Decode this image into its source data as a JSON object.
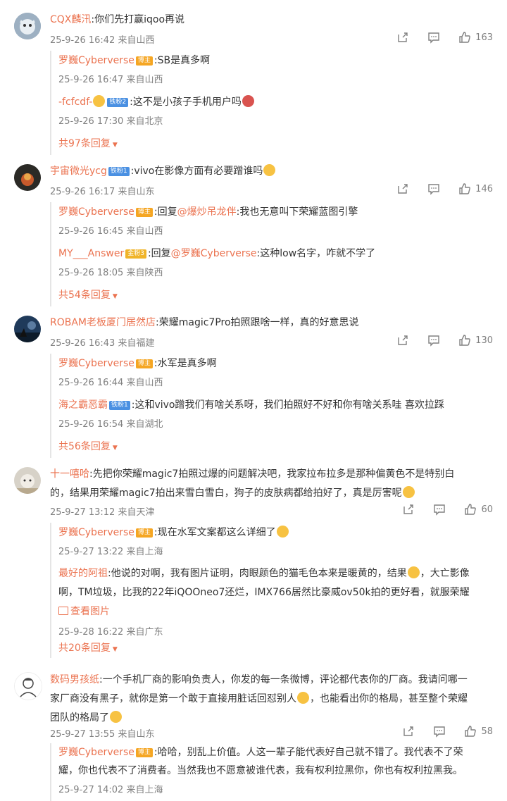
{
  "comments": [
    {
      "user": "CQX麟汛",
      "text": ":你们先打赢iqoo再说",
      "time": "25-9-26 16:42",
      "location": "来自山西",
      "likes": "163",
      "replies": [
        {
          "user": "罗巍Cyberverse",
          "badge": "博主",
          "text": ":SB是真多啊",
          "time": "25-9-26 16:47",
          "location": "来自山西"
        },
        {
          "user": "-fcfcdf-",
          "badge": "铁粉2",
          "text": ":这不是小孩子手机用户吗",
          "time": "25-9-26 17:30",
          "location": "来自北京"
        }
      ],
      "more": "共97条回复"
    },
    {
      "user": "宇宙微光ycg",
      "badge": "铁粉1",
      "text": ":vivo在影像方面有必要蹭谁吗",
      "time": "25-9-26 16:17",
      "location": "来自山东",
      "likes": "146",
      "replies": [
        {
          "user": "罗巍Cyberverse",
          "badge": "博主",
          "prefix": ":回复",
          "mention": "@爆炒吊龙伴",
          "text": ":我也无意叫下荣耀蓝图引擎",
          "time": "25-9-26 16:45",
          "location": "来自山西"
        },
        {
          "user": "MY___Answer",
          "badge": "金粉3",
          "prefix": ":回复",
          "mention": "@罗巍Cyberverse",
          "text": ":这种low名字，咋就不学了",
          "time": "25-9-26 18:05",
          "location": "来自陕西"
        }
      ],
      "more": "共54条回复"
    },
    {
      "user": "ROBAM老板厦门居然店",
      "text": ":荣耀magic7Pro拍照跟啥一样，真的好意思说",
      "time": "25-9-26 16:43",
      "location": "来自福建",
      "likes": "130",
      "replies": [
        {
          "user": "罗巍Cyberverse",
          "badge": "博主",
          "text": ":水军是真多啊",
          "time": "25-9-26 16:44",
          "location": "来自山西"
        },
        {
          "user": "海之霸恶霸",
          "badge": "铁粉1",
          "text": ":这和vivo蹭我们有啥关系呀，我们拍照好不好和你有啥关系哇 喜欢拉踩",
          "time": "25-9-26 16:54",
          "location": "来自湖北"
        }
      ],
      "more": "共56条回复"
    },
    {
      "user": "十一嘻哈",
      "text_line1": ":先把你荣耀magic7拍照过爆的问题解决吧，我家拉布拉多是那种偏黄色不是特别白",
      "text_line2": "的，结果用荣耀magic7拍出来雪白雪白，狗子的皮肤病都给拍好了，真是厉害呢",
      "time": "25-9-27 13:12",
      "location": "来自天津",
      "likes": "60",
      "replies": [
        {
          "user": "罗巍Cyberverse",
          "badge": "博主",
          "text": ":现在水军文案都这么详细了",
          "time": "25-9-27 13:22",
          "location": "来自上海"
        },
        {
          "user": "最好的阿祖",
          "text_line1": ":他说的对啊，我有图片证明，肉眼颜色的猫毛色本来是暖黄的，结果",
          "text_line1b": "，大亡影像",
          "text_line2": "啊，TM垃圾，比我的22年iQOOneo7还烂，IMX766居然比豪威ov50k拍的更好看，就服荣耀",
          "viewpic": "查看图片",
          "time": "25-9-28 16:22",
          "location": "来自广东"
        }
      ],
      "more": "共20条回复"
    },
    {
      "user": "数码男孩纸",
      "text_line1": ":一个手机厂商的影响负责人，你发的每一条微博，评论都代表你的厂商。我请问哪一",
      "text_line2a": "家厂商没有黑子，就你是第一个敢于直接用脏话回怼别人",
      "text_line2b": "，也能看出你的格局，甚至整个荣耀",
      "text_line3": "团队的格局了",
      "time": "25-9-27 13:55",
      "location": "来自山东",
      "likes": "58",
      "replies": [
        {
          "user": "罗巍Cyberverse",
          "badge": "博主",
          "text_line1": ":哈哈，别乱上价值。人这一辈子能代表好自己就不错了。我代表不了荣",
          "text_line2": "耀，你也代表不了消费者。当然我也不愿意被谁代表，我有权利拉黑你，你也有权利拉黑我。",
          "time": "25-9-27 14:02",
          "location": "来自上海"
        }
      ]
    }
  ],
  "colors": {
    "accent": "#eb7350",
    "meta": "#808080",
    "text": "#333333"
  },
  "icons": [
    "share-icon",
    "comment-icon",
    "like-icon"
  ]
}
